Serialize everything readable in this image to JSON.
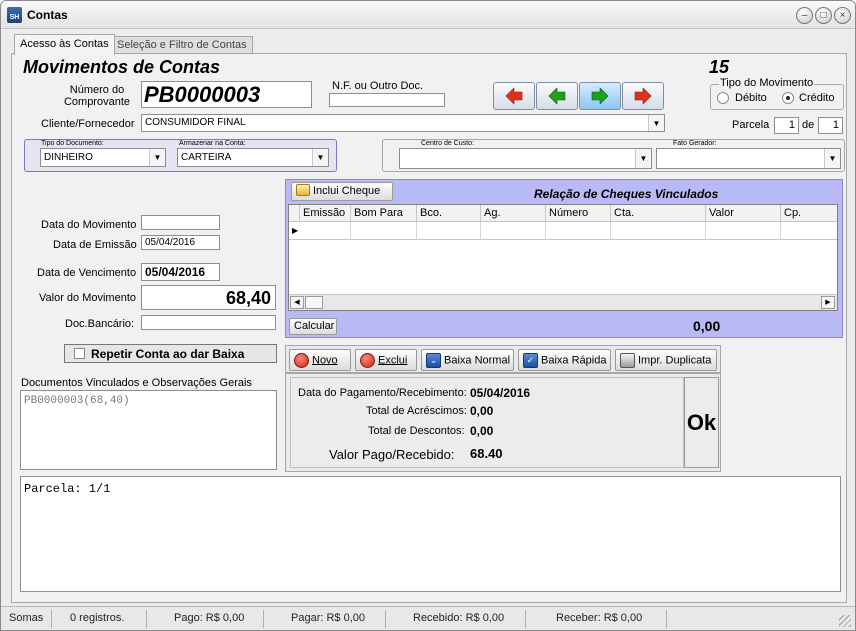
{
  "window": {
    "title": "Contas",
    "icon": "app-icon",
    "buttons": [
      "minimize-icon",
      "maximize-icon",
      "close-icon"
    ]
  },
  "tabs": [
    {
      "label": "Acesso às Contas",
      "active": true
    },
    {
      "label": "Seleção e Filtro de Contas",
      "active": false
    }
  ],
  "header": {
    "title": "Movimentos de Contas",
    "record_number": "15"
  },
  "comprovante": {
    "label": "Número do Comprovante",
    "value": "PB0000003"
  },
  "nf": {
    "label": "N.F. ou Outro Doc.",
    "value": ""
  },
  "nav_icons": [
    "arrow-first-icon",
    "arrow-prev-icon",
    "arrow-next-icon",
    "arrow-last-icon"
  ],
  "tipo_movimento": {
    "legend": "Tipo do Movimento",
    "options": [
      "Débito",
      "Crédito"
    ],
    "selected": "Crédito"
  },
  "cliente": {
    "label": "Cliente/Fornecedor",
    "value": "CONSUMIDOR FINAL"
  },
  "parcela": {
    "label": "Parcela",
    "current": "1",
    "of_label": "de",
    "total": "1"
  },
  "tipo_documento": {
    "label": "Tipo do Documento:",
    "value": "DINHEIRO"
  },
  "armazenar": {
    "label": "Armazenar na Conta:",
    "value": "CARTEIRA"
  },
  "centro_custo": {
    "label": "Centro de Custo:",
    "value": ""
  },
  "fato_gerador": {
    "label": "Fato Gerador:",
    "value": ""
  },
  "datas": {
    "movimento_label": "Data do Movimento",
    "movimento_value": "",
    "emissao_label": "Data de Emissão",
    "emissao_value": "05/04/2016",
    "vencimento_label": "Data de Vencimento",
    "vencimento_value": "05/04/2016"
  },
  "valor": {
    "label": "Valor do Movimento",
    "value": "68,40"
  },
  "doc_bancario": {
    "label": "Doc.Bancário:",
    "value": ""
  },
  "repetir": {
    "label": "Repetir Conta ao dar Baixa",
    "checked": false
  },
  "cheques": {
    "include_label": "Inclui Cheque",
    "title": "Relação de Cheques Vinculados",
    "columns": [
      "Emissão",
      "Bom Para",
      "Bco.",
      "Ag.",
      "Número",
      "Cta.",
      "Valor",
      "Cp."
    ],
    "calc_label": "Calcular",
    "total": "0,00"
  },
  "docs": {
    "label": "Documentos Vinculados e Observações Gerais",
    "value": "PB0000003(68,40)"
  },
  "actions": [
    {
      "label": "Novo",
      "icon": "add-icon"
    },
    {
      "label": "Exclui",
      "icon": "delete-icon"
    },
    {
      "label": "Baixa Normal",
      "icon": "chevron-down-icon"
    },
    {
      "label": "Baixa Rápida",
      "icon": "check-icon"
    },
    {
      "label": "Impr. Duplicata",
      "icon": "printer-icon"
    }
  ],
  "pagamento": {
    "data_label": "Data do Pagamento/Recebimento:",
    "data_value": "05/04/2016",
    "acrescimos_label": "Total de Acréscimos:",
    "acrescimos_value": "0,00",
    "descontos_label": "Total de Descontos:",
    "descontos_value": "0,00",
    "valor_label": "Valor Pago/Recebido:",
    "valor_value": "68.40",
    "ok_label": "Ok"
  },
  "notes": {
    "value": "Parcela: 1/1"
  },
  "status": {
    "somas": "Somas",
    "registros": "0 registros.",
    "pago": "Pago: R$ 0,00",
    "pagar": "Pagar: R$ 0,00",
    "recebido": "Recebido: R$ 0,00",
    "receber": "Receber: R$ 0,00"
  },
  "colors": {
    "accent_panel": "#b9b9f5",
    "group_border": "#7777cc",
    "nav_red": "#e0301e",
    "nav_green": "#1da11d"
  }
}
